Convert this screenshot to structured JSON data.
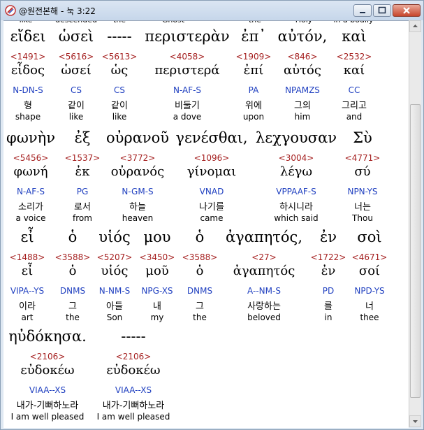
{
  "window": {
    "title": "@원전본해 - 눅 3:22",
    "minimize": "minimize",
    "maximize": "maximize",
    "close": "close"
  },
  "cutoff_top": [
    "like",
    "descended",
    "the",
    "Ghost",
    "the",
    "Holy",
    "in a bodily"
  ],
  "rows": [
    {
      "words": [
        {
          "greek": "εἴδει",
          "strong": "<1491>",
          "lex": "εἶδος",
          "parse": "N-DN-S",
          "kor": "형",
          "eng": "shape"
        },
        {
          "greek": "ὡσεὶ",
          "strong": "<5616>",
          "lex": "ὡσεί",
          "parse": "CS",
          "kor": "같이",
          "eng": "like"
        },
        {
          "greek": "-----",
          "strong": "<5613>",
          "lex": "ὡς",
          "parse": "CS",
          "kor": "같이",
          "eng": "like"
        },
        {
          "greek": "περιστερὰν",
          "strong": "<4058>",
          "lex": "περιστερά",
          "parse": "N-AF-S",
          "kor": "비둘기",
          "eng": "a dove"
        },
        {
          "greek": "ἐπ᾽",
          "strong": "<1909>",
          "lex": "ἐπί",
          "parse": "PA",
          "kor": "위에",
          "eng": "upon"
        },
        {
          "greek": "αὐτόν,",
          "strong": "<846>",
          "lex": "αὐτός",
          "parse": "NPAMZS",
          "kor": "그의",
          "eng": "him"
        },
        {
          "greek": "καὶ",
          "strong": "<2532>",
          "lex": "καί",
          "parse": "CC",
          "kor": "그리고",
          "eng": "and"
        }
      ]
    },
    {
      "words": [
        {
          "greek": "φωνὴν",
          "strong": "<5456>",
          "lex": "φωνή",
          "parse": "N-AF-S",
          "kor": "소리가",
          "eng": "a voice"
        },
        {
          "greek": "ἐξ",
          "strong": "<1537>",
          "lex": "ἐκ",
          "parse": "PG",
          "kor": "로서",
          "eng": "from"
        },
        {
          "greek": "οὐρανοῦ",
          "strong": "<3772>",
          "lex": "οὐρανός",
          "parse": "N-GM-S",
          "kor": "하늘",
          "eng": "heaven"
        },
        {
          "greek": "γενέσθαι,",
          "strong": "<1096>",
          "lex": "γίνομαι",
          "parse": "VNAD",
          "kor": "나기를",
          "eng": "came"
        },
        {
          "greek": "λεχγουσαν",
          "strong": "<3004>",
          "lex": "λέγω",
          "parse": "VPPAAF-S",
          "kor": "하시니라",
          "eng": "which said"
        },
        {
          "greek": "Σὺ",
          "strong": "<4771>",
          "lex": "σύ",
          "parse": "NPN-YS",
          "kor": "너는",
          "eng": "Thou"
        }
      ]
    },
    {
      "words": [
        {
          "greek": "εἶ",
          "strong": "<1488>",
          "lex": "εἶ",
          "parse": "VIPA--YS",
          "kor": "이라",
          "eng": "art"
        },
        {
          "greek": "ὁ",
          "strong": "<3588>",
          "lex": "ὁ",
          "parse": "DNMS",
          "kor": "그",
          "eng": "the"
        },
        {
          "greek": "υἱός",
          "strong": "<5207>",
          "lex": "υἱός",
          "parse": "N-NM-S",
          "kor": "아들",
          "eng": "Son"
        },
        {
          "greek": "μου",
          "strong": "<3450>",
          "lex": "μοῦ",
          "parse": "NPG-XS",
          "kor": "내",
          "eng": "my"
        },
        {
          "greek": "ὁ",
          "strong": "<3588>",
          "lex": "ὁ",
          "parse": "DNMS",
          "kor": "그",
          "eng": "the"
        },
        {
          "greek": "ἀγαπητός,",
          "strong": "<27>",
          "lex": "ἀγαπητός",
          "parse": "A--NM-S",
          "kor": "사랑하는",
          "eng": "beloved"
        },
        {
          "greek": "ἐν",
          "strong": "<1722>",
          "lex": "ἐν",
          "parse": "PD",
          "kor": "를",
          "eng": "in"
        },
        {
          "greek": "σοὶ",
          "strong": "<4671>",
          "lex": "σοί",
          "parse": "NPD-YS",
          "kor": "너",
          "eng": "thee"
        }
      ]
    },
    {
      "words": [
        {
          "greek": "ηὐδόκησα.",
          "strong": "<2106>",
          "lex": "εὐδοκέω",
          "parse": "VIAA--XS",
          "kor": "내가-기뻐하노라",
          "eng": "I am well pleased"
        },
        {
          "greek": "-----",
          "strong": "<2106>",
          "lex": "εὐδοκέω",
          "parse": "VIAA--XS",
          "kor": "내가-기뻐하노라",
          "eng": "I am well pleased"
        }
      ]
    }
  ]
}
